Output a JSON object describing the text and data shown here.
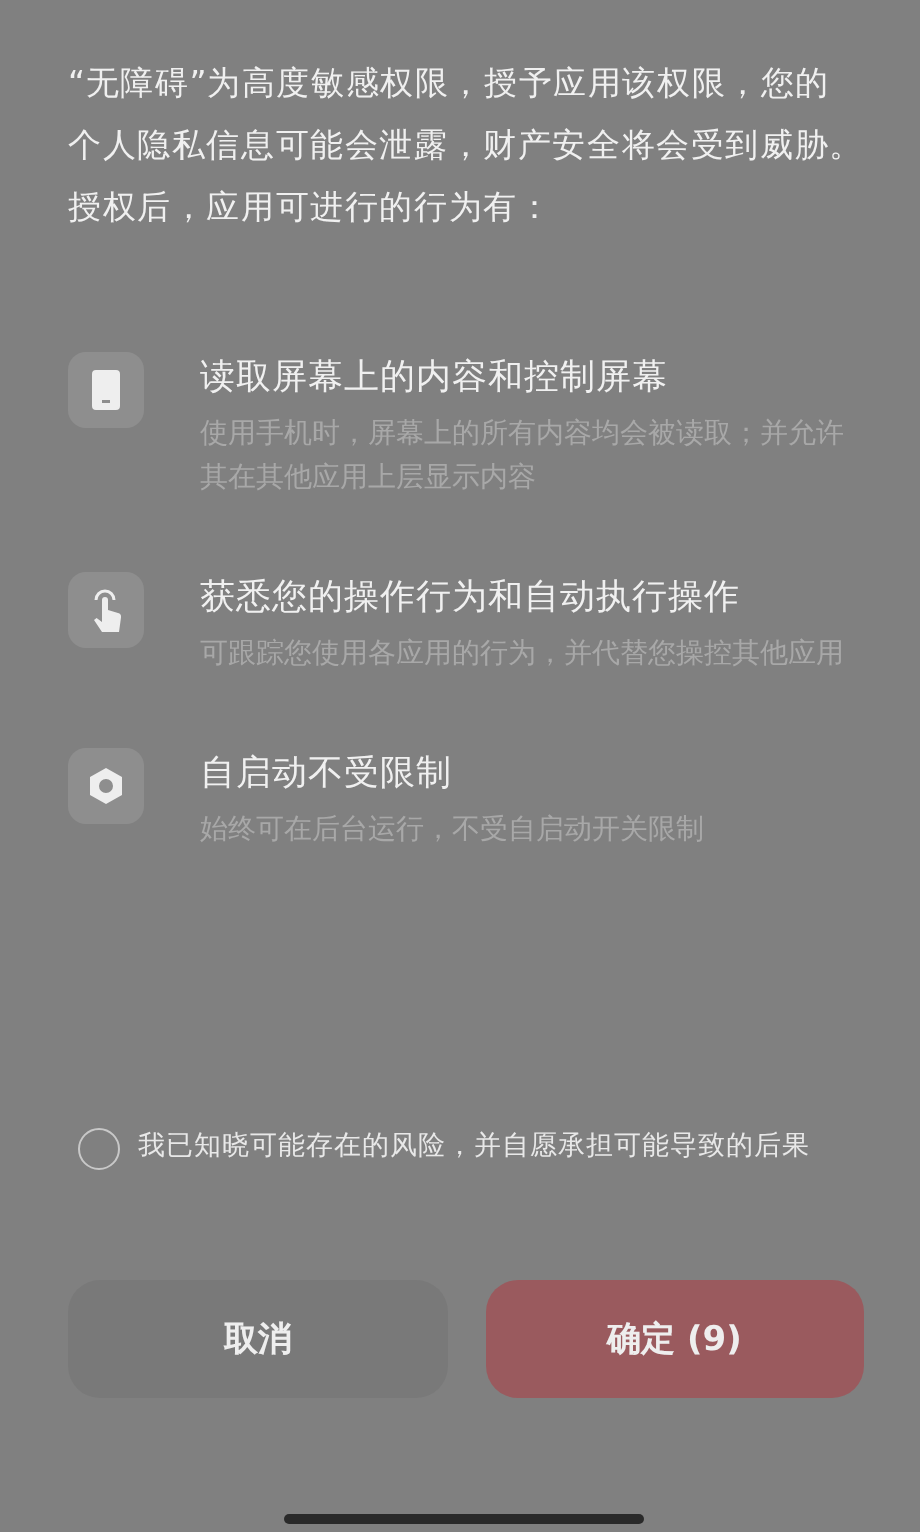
{
  "intro": "“无障碍”为高度敏感权限，授予应用该权限，您的个人隐私信息可能会泄露，财产安全将会受到威胁。授权后，应用可进行的行为有：",
  "permissions": [
    {
      "title": "读取屏幕上的内容和控制屏幕",
      "description": "使用手机时，屏幕上的所有内容均会被读取；并允许其在其他应用上层显示内容"
    },
    {
      "title": "获悉您的操作行为和自动执行操作",
      "description": "可跟踪您使用各应用的行为，并代替您操控其他应用"
    },
    {
      "title": "自启动不受限制",
      "description": "始终可在后台运行，不受自启动开关限制"
    }
  ],
  "consent": {
    "label": "我已知晓可能存在的风险，并自愿承担可能导致的后果",
    "checked": false
  },
  "buttons": [
    {
      "label": "取消",
      "kind": "cancel"
    },
    {
      "label": "确定 (9)",
      "kind": "confirm"
    }
  ]
}
